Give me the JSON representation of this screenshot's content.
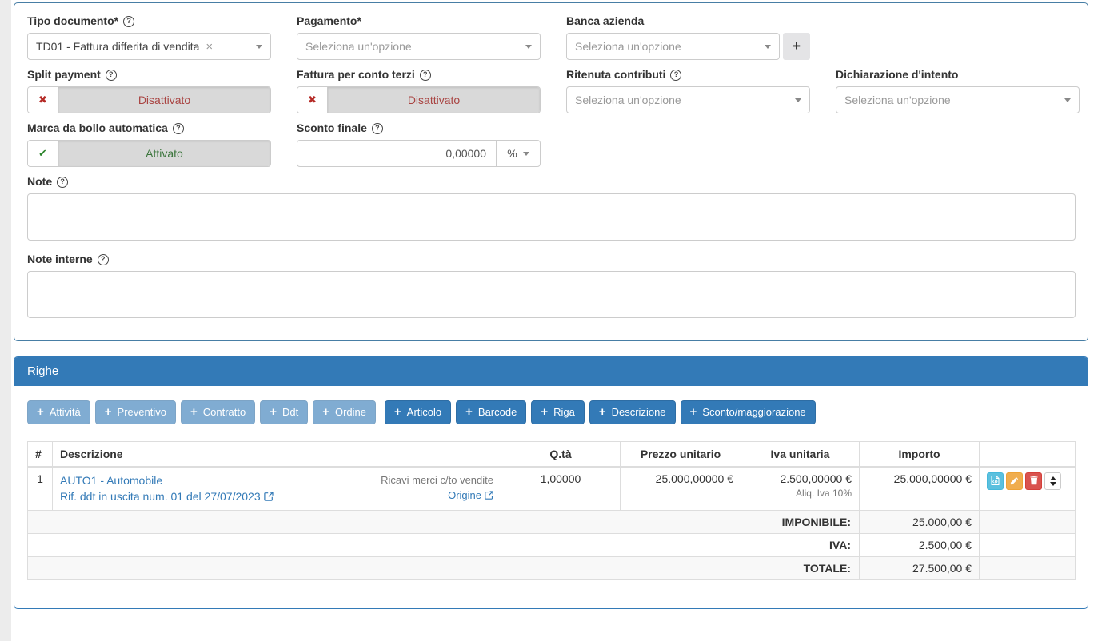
{
  "icons": {
    "help": "?",
    "clear": "×",
    "cross": "✖",
    "check": "✔",
    "plus": "+"
  },
  "colors": {
    "accent": "#337ab7",
    "info": "#5bc0de",
    "warning": "#f0ad4e",
    "danger": "#d9534f",
    "success_text": "#3c763d",
    "danger_text": "#a94442"
  },
  "form": {
    "tipo_documento": {
      "label": "Tipo documento*",
      "value": "TD01 - Fattura differita di vendita"
    },
    "pagamento": {
      "label": "Pagamento*",
      "placeholder": "Seleziona un'opzione"
    },
    "banca_azienda": {
      "label": "Banca azienda",
      "placeholder": "Seleziona un'opzione"
    },
    "split_payment": {
      "label": "Split payment",
      "state": "Disattivato"
    },
    "fattura_conto_terzi": {
      "label": "Fattura per conto terzi",
      "state": "Disattivato"
    },
    "ritenuta_contributi": {
      "label": "Ritenuta contributi",
      "placeholder": "Seleziona un'opzione"
    },
    "dichiarazione_intento": {
      "label": "Dichiarazione d'intento",
      "placeholder": "Seleziona un'opzione"
    },
    "marca_da_bollo": {
      "label": "Marca da bollo automatica",
      "state": "Attivato"
    },
    "sconto_finale": {
      "label": "Sconto finale",
      "value": "0,00000",
      "unit": "%"
    },
    "note": {
      "label": "Note"
    },
    "note_interne": {
      "label": "Note interne"
    }
  },
  "righe": {
    "title": "Righe",
    "toolbar": [
      {
        "label": "Attività",
        "muted": true
      },
      {
        "label": "Preventivo",
        "muted": true
      },
      {
        "label": "Contratto",
        "muted": true
      },
      {
        "label": "Ddt",
        "muted": true
      },
      {
        "label": "Ordine",
        "muted": true
      },
      {
        "label": "Articolo",
        "muted": false
      },
      {
        "label": "Barcode",
        "muted": false
      },
      {
        "label": "Riga",
        "muted": false
      },
      {
        "label": "Descrizione",
        "muted": false
      },
      {
        "label": "Sconto/maggiorazione",
        "muted": false
      }
    ],
    "table": {
      "headers": {
        "num": "#",
        "descrizione": "Descrizione",
        "qta": "Q.tà",
        "prezzo": "Prezzo unitario",
        "iva": "Iva unitaria",
        "importo": "Importo"
      },
      "rows": [
        {
          "num": "1",
          "title": "AUTO1 - Automobile",
          "rif": "Rif. ddt in uscita num. 01 del 27/07/2023",
          "conto": "Ricavi merci c/to vendite",
          "origine": "Origine",
          "qta": "1,00000",
          "prezzo": "25.000,00000 €",
          "iva": "2.500,00000 €",
          "iva_note": "Aliq. Iva 10%",
          "importo": "25.000,00000 €"
        }
      ],
      "summary": [
        {
          "label": "IMPONIBILE:",
          "value": "25.000,00 €"
        },
        {
          "label": "IVA:",
          "value": "2.500,00 €"
        },
        {
          "label": "TOTALE:",
          "value": "27.500,00 €"
        }
      ]
    }
  }
}
